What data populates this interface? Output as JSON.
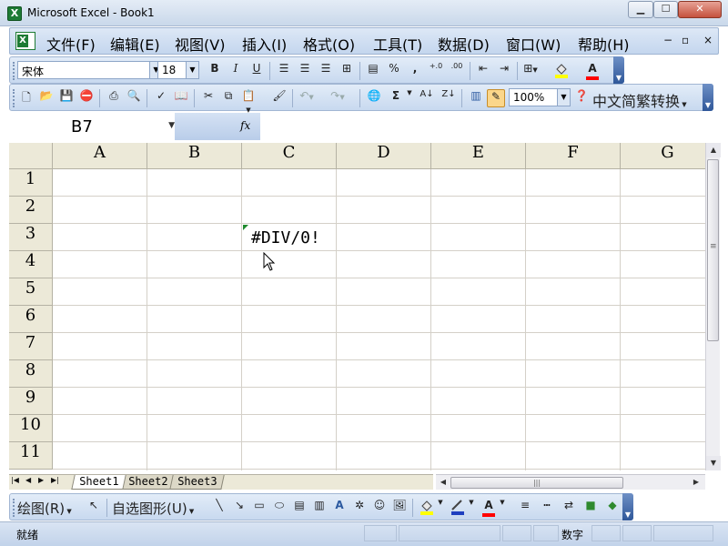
{
  "window": {
    "title": "Microsoft Excel - Book1",
    "app_icon": "excel-icon"
  },
  "menu": {
    "items": [
      "文件(F)",
      "编辑(E)",
      "视图(V)",
      "插入(I)",
      "格式(O)",
      "工具(T)",
      "数据(D)",
      "窗口(W)",
      "帮助(H)"
    ],
    "mdi_min": "−",
    "mdi_restore": "▫",
    "mdi_close": "×"
  },
  "formatting_toolbar": {
    "font_name": "宋体",
    "font_size": "18",
    "icons": [
      "bold-icon",
      "italic-icon",
      "underline-icon",
      "align-left-icon",
      "align-center-icon",
      "align-right-icon",
      "merge-center-icon",
      "currency-icon",
      "percent-icon",
      "comma-icon",
      "increase-decimal-icon",
      "decrease-decimal-icon",
      "decrease-indent-icon",
      "borders-icon",
      "fill-color-icon",
      "font-color-icon"
    ],
    "bold": "B",
    "italic": "I",
    "underline": "U",
    "percent": "%",
    "comma": ",",
    "inc_dec": "+.0",
    "dec_dec": ".00",
    "fill_color": "#ffff00",
    "font_color": "#ff0000"
  },
  "standard_toolbar": {
    "icons": [
      "new-icon",
      "open-icon",
      "save-icon",
      "permission-icon",
      "print-icon",
      "print-preview-icon",
      "spelling-icon",
      "research-icon",
      "cut-icon",
      "copy-icon",
      "paste-icon",
      "format-painter-icon",
      "undo-icon",
      "redo-icon",
      "hyperlink-icon",
      "autosum-icon",
      "sort-ascending-icon",
      "sort-descending-icon",
      "chart-wizard-icon",
      "drawing-icon",
      "help-icon"
    ],
    "autosum": "Σ",
    "zoom": "100%",
    "chinese_convert": "中文简繁转换"
  },
  "formula_bar": {
    "name_box": "B7",
    "fx": "fx",
    "formula": ""
  },
  "grid": {
    "columns": [
      "A",
      "B",
      "C",
      "D",
      "E",
      "F",
      "G"
    ],
    "rows": [
      "1",
      "2",
      "3",
      "4",
      "5",
      "6",
      "7",
      "8",
      "9",
      "10",
      "11"
    ],
    "cells": [
      {
        "ref": "C3",
        "value": "#DIV/0!"
      }
    ]
  },
  "sheet_tabs": {
    "tabs": [
      "Sheet1",
      "Sheet2",
      "Sheet3"
    ],
    "active": "Sheet1"
  },
  "drawing_toolbar": {
    "draw_label": "绘图(R)",
    "autoshapes_label": "自选图形(U)",
    "icons": [
      "select-objects-icon",
      "line-icon",
      "arrow-icon",
      "rectangle-icon",
      "oval-icon",
      "textbox-icon",
      "vertical-textbox-icon",
      "wordart-icon",
      "diagram-icon",
      "clipart-icon",
      "picture-icon",
      "fill-color-icon",
      "line-color-icon",
      "font-color-icon",
      "line-style-icon",
      "dash-style-icon",
      "arrow-style-icon",
      "shadow-icon",
      "3d-icon"
    ],
    "font_color_letter": "A"
  },
  "status_bar": {
    "ready": "就绪",
    "num_mode": "数字"
  }
}
